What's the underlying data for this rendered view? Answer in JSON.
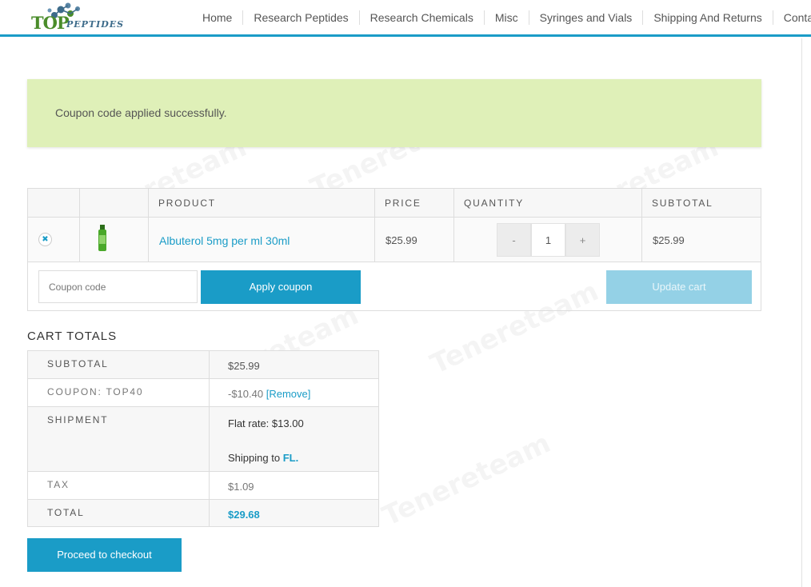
{
  "logo": {
    "top": "TOP",
    "peptides": "PEPTIDES"
  },
  "nav": [
    "Home",
    "Research Peptides",
    "Research Chemicals",
    "Misc",
    "Syringes and Vials",
    "Shipping And Returns",
    "Contact"
  ],
  "notice": "Coupon code applied successfully.",
  "cart": {
    "headers": {
      "product": "PRODUCT",
      "price": "PRICE",
      "quantity": "QUANTITY",
      "subtotal": "SUBTOTAL"
    },
    "items": [
      {
        "name": "Albuterol 5mg per ml 30ml",
        "price": "$25.99",
        "quantity": "1",
        "subtotal": "$25.99"
      }
    ],
    "qty_minus": "-",
    "qty_plus": "+",
    "coupon_placeholder": "Coupon code",
    "apply_label": "Apply coupon",
    "update_label": "Update cart"
  },
  "totals": {
    "title": "CART TOTALS",
    "subtotal_label": "SUBTOTAL",
    "subtotal": "$25.99",
    "coupon_label": "COUPON: TOP40",
    "coupon_value": "-$10.40",
    "coupon_remove": "[Remove]",
    "shipment_label": "SHIPMENT",
    "shipment_rate_label": "Flat rate:",
    "shipment_rate": "$13.00",
    "shipping_to_label": "Shipping to",
    "shipping_to": "FL.",
    "tax_label": "TAX",
    "tax": "$1.09",
    "total_label": "TOTAL",
    "total": "$29.68"
  },
  "checkout_label": "Proceed to checkout",
  "watermark": "Tenereteam",
  "colors": {
    "accent": "#1a9cc7",
    "notice_bg": "#dff0b8",
    "update_disabled": "#94d1e6"
  }
}
